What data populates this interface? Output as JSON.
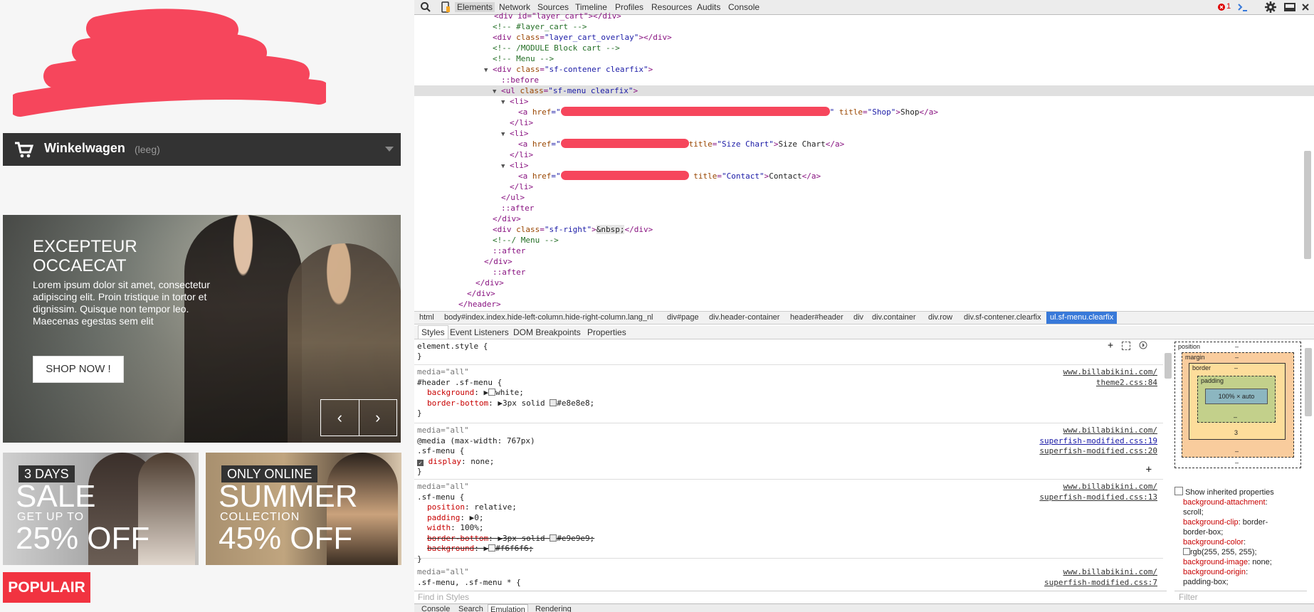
{
  "site": {
    "cart": {
      "title": "Winkelwagen",
      "status": "(leeg)"
    },
    "hero": {
      "title_line1": "EXCEPTEUR",
      "title_line2": "OCCAECAT",
      "text": "Lorem ipsum dolor sit amet, consectetur adipiscing elit. Proin tristique in tortor et dignissim. Quisque non tempor leo. Maecenas egestas sem elit",
      "button": "SHOP NOW !",
      "prev": "‹",
      "next": "›"
    },
    "banners": [
      {
        "tag": "3 DAYS",
        "big": "SALE",
        "small": "GET UP TO",
        "pct": "25% OFF"
      },
      {
        "tag": "ONLY ONLINE",
        "big": "SUMMER",
        "small": "COLLECTION",
        "pct": "45% OFF"
      }
    ],
    "populair": "POPULAIR"
  },
  "devtools": {
    "tabs": [
      "Elements",
      "Network",
      "Sources",
      "Timeline",
      "Profiles",
      "Resources",
      "Audits",
      "Console"
    ],
    "active_tab": "Elements",
    "error_count": "1",
    "dom": {
      "l0": "<div id=\"layer_cart\"></div>",
      "l1": "<!-- #layer_cart -->",
      "l2a": "<div",
      "l2b": "class",
      "l2c": "\"layer_cart_overlay\"",
      "l2d": "></div>",
      "l3": "<!-- /MODULE Block cart -->",
      "l4": "<!-- Menu -->",
      "l5a": "<div",
      "l5b": "class",
      "l5c": "\"sf-contener clearfix\"",
      "l5d": ">",
      "l6": "::before",
      "l7a": "<ul",
      "l7b": "class",
      "l7c": "\"sf-menu clearfix\"",
      "l7d": ">",
      "li_open": "<li>",
      "li_close": "</li>",
      "a_open": "<a",
      "href": "href",
      "quote": "=\"",
      "title": "title",
      "item1_title": "\"Shop\"",
      "item1_text": "Shop",
      "item2_title": "\"Size Chart\"",
      "item2_text": "Size Chart",
      "item3_title": "\"Contact\"",
      "item3_text": "Contact",
      "a_close": "</a>",
      "ul_close": "</ul>",
      "after": "::after",
      "div_close": "</div>",
      "sfright_a": "<div",
      "sfright_b": "class",
      "sfright_c": "\"sf-right\"",
      "sfright_d": ">",
      "nbsp": "&nbsp;",
      "sfright_e": "</div>",
      "menu_end": "<!--/ Menu -->",
      "header_close": "</header>"
    },
    "breadcrumb": [
      "html",
      "body#index.index.hide-left-column.hide-right-column.lang_nl",
      "div#page",
      "div.header-container",
      "header#header",
      "div",
      "div.container",
      "div.row",
      "div.sf-contener.clearfix",
      "ul.sf-menu.clearfix"
    ],
    "style_tabs": [
      "Styles",
      "Event Listeners",
      "DOM Breakpoints",
      "Properties"
    ],
    "styles": {
      "element_style": "element.style {",
      "close": "}",
      "media_all": "media=\"all\"",
      "r1_sel": "#header .sf-menu {",
      "r1_p1": "background",
      "r1_v1": "white;",
      "r1_p2": "border-bottom",
      "r1_v2a": "3px solid",
      "r1_v2b": "#e8e8e8;",
      "r1_link1": "www.billabikini.com/",
      "r1_link2": "theme2.css:84",
      "r2_media": "@media (max-width: 767px)",
      "r2_sel": ".sf-menu {",
      "r2_p1": "display",
      "r2_v1": "none;",
      "r2_link1": "www.billabikini.com/",
      "r2_link2": "superfish-modified.css:19",
      "r2_link3": "superfish-modified.css:20",
      "r3_sel": ".sf-menu {",
      "r3_p1": "position",
      "r3_v1": "relative;",
      "r3_p2": "padding",
      "r3_v2": "0;",
      "r3_p3": "width",
      "r3_v3": "100%;",
      "r3_p4": "border-bottom",
      "r3_v4a": "3px solid",
      "r3_v4b": "#e9e9e9;",
      "r3_p5": "background",
      "r3_v5": "#f6f6f6;",
      "r3_link1": "www.billabikini.com/",
      "r3_link2": "superfish-modified.css:13",
      "r4_sel": ".sf-menu, .sf-menu * {",
      "r4_link1": "www.billabikini.com/",
      "r4_link2": "superfish-modified.css:7",
      "find": "Find in Styles"
    },
    "boxmodel": {
      "position": "position",
      "margin": "margin",
      "border": "border",
      "padding": "padding",
      "dash": "–",
      "content": "100% × auto",
      "border_bottom": "3"
    },
    "computed": {
      "show_inherited": "Show inherited properties",
      "p1": "background-attachment",
      "v1": "scroll;",
      "p2": "background-clip",
      "v2": "border-box;",
      "p3": "background-color",
      "v3": "rgb(255, 255, 255);",
      "p4": "background-image",
      "v4": "none;",
      "p5": "background-origin",
      "v5": "padding-box;",
      "filter": "Filter"
    },
    "drawer_tabs": [
      "Console",
      "Search",
      "Emulation",
      "Rendering"
    ]
  }
}
